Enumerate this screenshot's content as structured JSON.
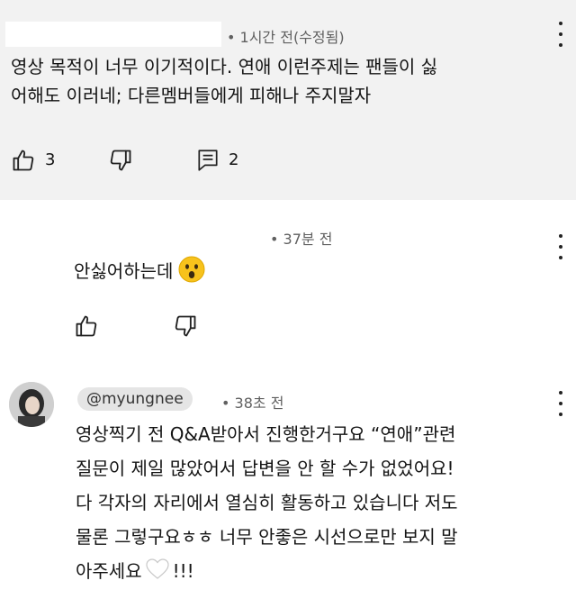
{
  "comment1": {
    "time": "• 1시간 전(수정됨)",
    "line1": "영상 목적이 너무 이기적이다. 연애 이런주제는 팬들이 싫",
    "line2": "어해도 이러네; 다른멤버들에게 피해나 주지말자",
    "likes": "3",
    "replies": "2"
  },
  "comment2": {
    "time": "• 37분 전",
    "text": "안싫어하는데"
  },
  "comment3": {
    "handle": "@myungnee",
    "time": "• 38초 전",
    "line1": "영상찍기 전 Q&A받아서 진행한거구요 “연애”관련",
    "line2": "질문이 제일 많았어서 답변을 안 할 수가 없었어요!",
    "line3": "다 각자의 자리에서 열심히 활동하고 있습니다 저도",
    "line4": "물론 그렇구요ㅎㅎ 너무 안좋은 시선으로만 보지 말",
    "line5": "아주세요",
    "line5_end": "!!!"
  },
  "icons": {
    "like": "thumbs-up-icon",
    "dislike": "thumbs-down-icon",
    "reply": "comment-reply-icon",
    "more": "more-vertical-icon",
    "emoji": "astonished-face-emoji",
    "heart": "white-heart-emoji"
  }
}
